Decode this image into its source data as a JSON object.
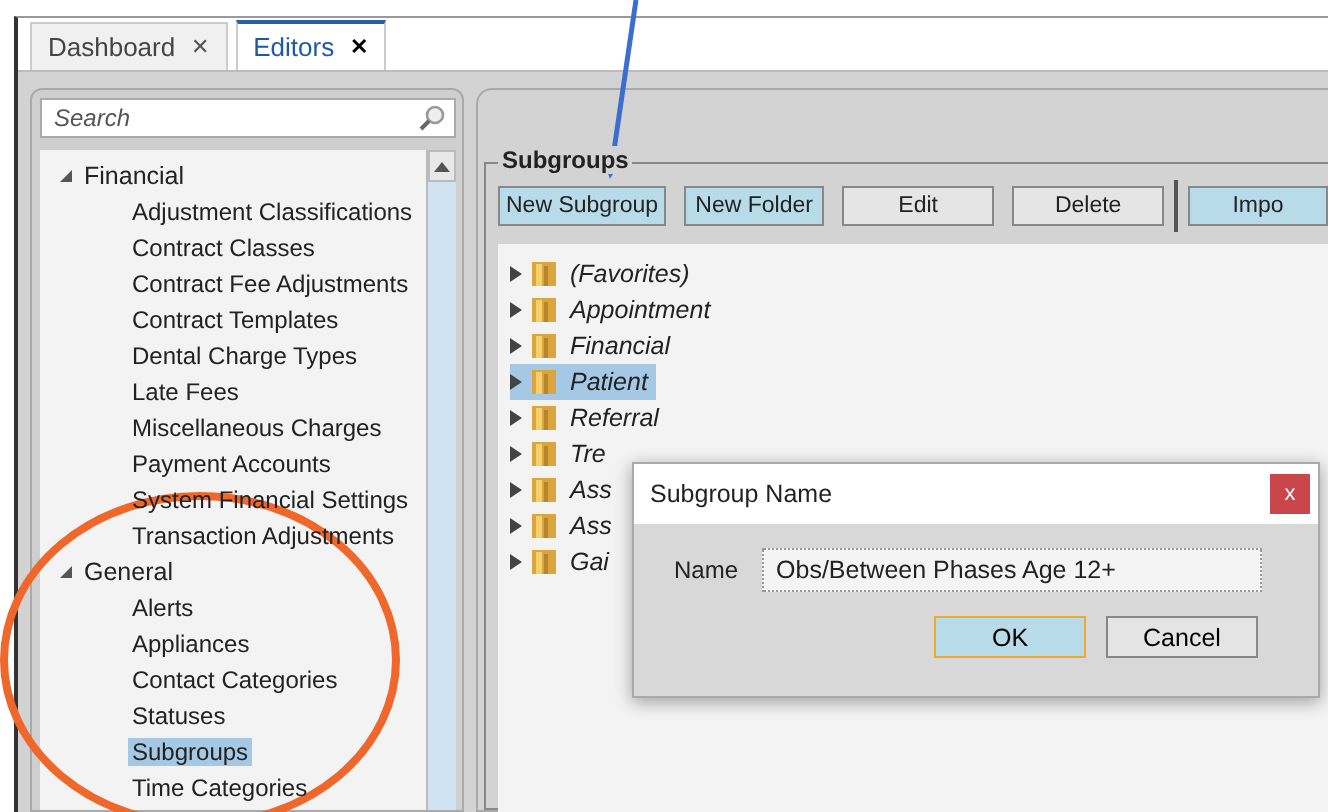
{
  "tabs": [
    {
      "label": "Dashboard",
      "close": "✕",
      "selected": false
    },
    {
      "label": "Editors",
      "close": "✕",
      "selected": true
    }
  ],
  "search": {
    "placeholder": "Search"
  },
  "sidebar": {
    "items": [
      {
        "label": "Financial",
        "expanded": true,
        "children": [
          {
            "label": "Adjustment Classifications",
            "selected": false
          },
          {
            "label": "Contract Classes",
            "selected": false
          },
          {
            "label": "Contract Fee Adjustments",
            "selected": false
          },
          {
            "label": "Contract Templates",
            "selected": false
          },
          {
            "label": "Dental Charge Types",
            "selected": false
          },
          {
            "label": "Late Fees",
            "selected": false
          },
          {
            "label": "Miscellaneous Charges",
            "selected": false
          },
          {
            "label": "Payment Accounts",
            "selected": false
          },
          {
            "label": "System Financial Settings",
            "selected": false
          },
          {
            "label": "Transaction Adjustments",
            "selected": false
          }
        ]
      },
      {
        "label": "General",
        "expanded": true,
        "children": [
          {
            "label": "Alerts",
            "selected": false
          },
          {
            "label": "Appliances",
            "selected": false
          },
          {
            "label": "Contact Categories",
            "selected": false
          },
          {
            "label": "Statuses",
            "selected": false
          },
          {
            "label": "Subgroups",
            "selected": true
          },
          {
            "label": "Time Categories",
            "selected": false
          }
        ]
      }
    ]
  },
  "subgroup": {
    "title": "Subgroups",
    "buttons": [
      {
        "label": "New Subgroup",
        "kind": "accent"
      },
      {
        "label": "New Folder",
        "kind": "accent"
      },
      {
        "label": "Edit",
        "kind": "plain"
      },
      {
        "label": "Delete",
        "kind": "plain"
      },
      {
        "label": "Impo",
        "kind": "accent"
      }
    ],
    "folders": [
      {
        "label": "(Favorites)",
        "selected": false
      },
      {
        "label": "Appointment",
        "selected": false
      },
      {
        "label": "Financial",
        "selected": false
      },
      {
        "label": "Patient",
        "selected": true
      },
      {
        "label": "Referral",
        "selected": false
      },
      {
        "label": "Tre",
        "selected": false
      },
      {
        "label": "Ass",
        "selected": false
      },
      {
        "label": "Ass",
        "selected": false
      },
      {
        "label": "Gai",
        "selected": false
      }
    ]
  },
  "dialog": {
    "title": "Subgroup Name",
    "close": "x",
    "field_label": "Name",
    "value": "Obs/Between Phases Age 12+",
    "buttons": [
      {
        "label": "OK",
        "default": true
      },
      {
        "label": "Cancel",
        "default": false
      }
    ]
  }
}
